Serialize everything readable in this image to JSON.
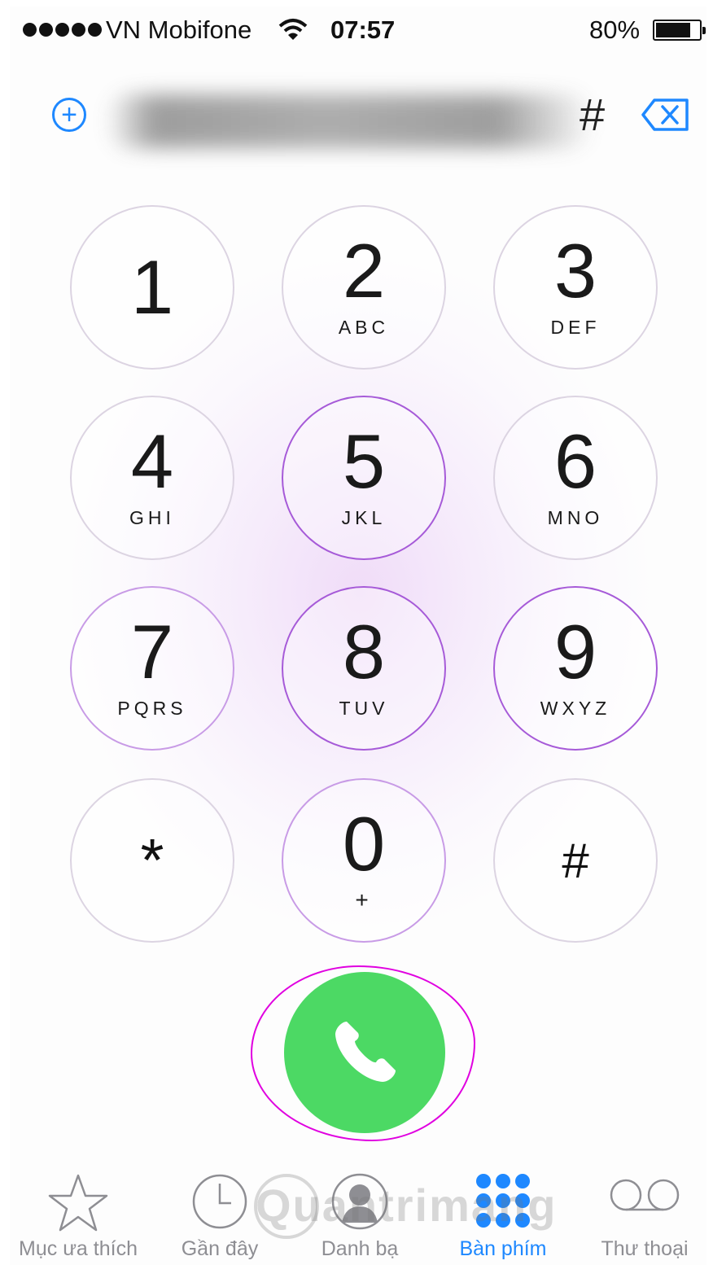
{
  "status_bar": {
    "signal_dots": 5,
    "carrier": "VN Mobifone",
    "wifi_icon": "wifi-icon",
    "time": "07:57",
    "battery_percent": "80%",
    "battery_level": 0.8
  },
  "display": {
    "add_contact_icon": "plus-circle-icon",
    "number_visible": "#",
    "number_obscured": true,
    "delete_icon": "backspace-icon"
  },
  "keypad": [
    {
      "digit": "1",
      "letters": ""
    },
    {
      "digit": "2",
      "letters": "ABC"
    },
    {
      "digit": "3",
      "letters": "DEF"
    },
    {
      "digit": "4",
      "letters": "GHI"
    },
    {
      "digit": "5",
      "letters": "JKL"
    },
    {
      "digit": "6",
      "letters": "MNO"
    },
    {
      "digit": "7",
      "letters": "PQRS"
    },
    {
      "digit": "8",
      "letters": "TUV"
    },
    {
      "digit": "9",
      "letters": "WXYZ"
    },
    {
      "digit": "*",
      "letters": ""
    },
    {
      "digit": "0",
      "letters": "+"
    },
    {
      "digit": "#",
      "letters": ""
    }
  ],
  "call_button": {
    "icon": "phone-icon",
    "color": "#4cd964",
    "annotation_color": "#e000e0"
  },
  "tab_bar": {
    "accent_color": "#1e88ff",
    "tabs": [
      {
        "label": "Mục ưa thích",
        "icon": "star-icon",
        "active": false
      },
      {
        "label": "Gần đây",
        "icon": "clock-icon",
        "active": false
      },
      {
        "label": "Danh bạ",
        "icon": "contacts-icon",
        "active": false
      },
      {
        "label": "Bàn phím",
        "icon": "keypad-icon",
        "active": true
      },
      {
        "label": "Thư thoại",
        "icon": "voicemail-icon",
        "active": false
      }
    ]
  },
  "watermark": "Quantrimang"
}
